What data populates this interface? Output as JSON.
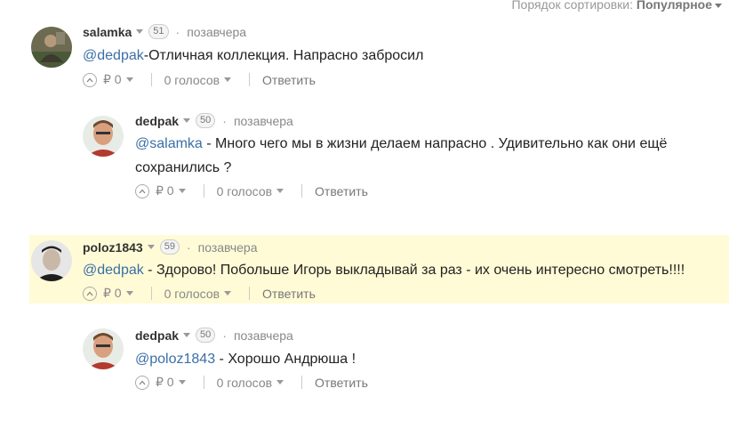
{
  "sort": {
    "label": "Порядок сортировки:",
    "value": "Популярное"
  },
  "comments": [
    {
      "author": "salamka",
      "rating": "51",
      "time": "позавчера",
      "mention": "@dedpak",
      "text": "-Отличная коллекция. Напрасно забросил",
      "money": "₽ 0",
      "votes": "0 голосов",
      "reply": "Ответить"
    },
    {
      "author": "dedpak",
      "rating": "50",
      "time": "позавчера",
      "mention": "@salamka",
      "text": " - Много чего мы в жизни делаем напрасно . Удивительно как они ещё сохранились ?",
      "money": "₽ 0",
      "votes": "0 голосов",
      "reply": "Ответить"
    },
    {
      "author": "poloz1843",
      "rating": "59",
      "time": "позавчера",
      "mention": "@dedpak",
      "text": " - Здорово! Побольше Игорь выкладывай за раз - их очень интересно смотреть!!!!",
      "money": "₽ 0",
      "votes": "0 голосов",
      "reply": "Ответить"
    },
    {
      "author": "dedpak",
      "rating": "50",
      "time": "позавчера",
      "mention": "@poloz1843",
      "text": " - Хорошо Андрюша !",
      "money": "₽ 0",
      "votes": "0 голосов",
      "reply": "Ответить"
    }
  ]
}
